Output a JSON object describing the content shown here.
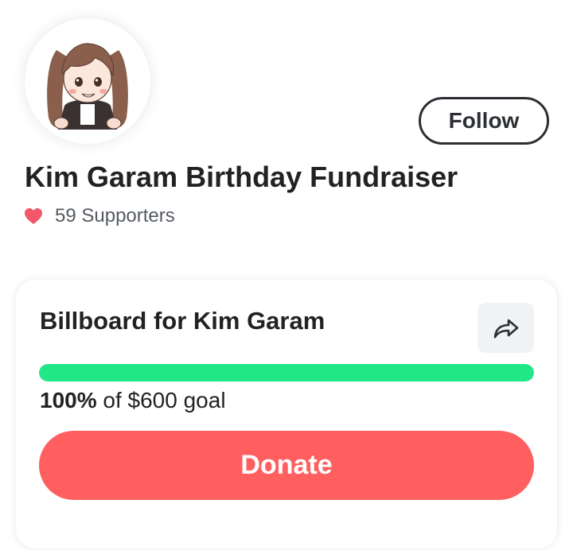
{
  "header": {
    "title": "Kim Garam Birthday Fundraiser",
    "follow_label": "Follow",
    "supporters_text": "59 Supporters"
  },
  "campaign": {
    "title": "Billboard for Kim Garam",
    "progress_fraction": 1.0,
    "progress_percent_text": "100%",
    "goal_text": "of $600 goal",
    "donate_label": "Donate"
  },
  "icons": {
    "avatar": "chibi-character-avatar",
    "supporters": "heart-icon",
    "share": "share-arrow-icon"
  },
  "colors": {
    "progress": "#21e786",
    "donate": "#ff5f5f",
    "heart": "#f2576a",
    "text": "#222222"
  }
}
